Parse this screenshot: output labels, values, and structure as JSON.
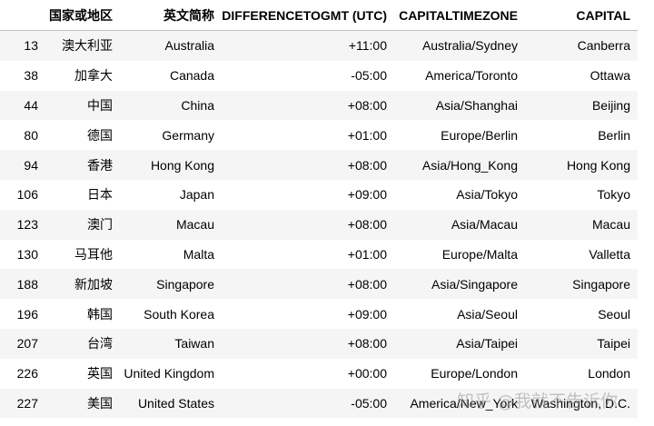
{
  "table": {
    "headers": [
      "",
      "国家或地区",
      "英文简称",
      "DIFFERENCETOGMT (UTC)",
      "CAPITALTIMEZONE",
      "CAPITAL"
    ],
    "rows": [
      [
        "13",
        "澳大利亚",
        "Australia",
        "+11:00",
        "Australia/Sydney",
        "Canberra"
      ],
      [
        "38",
        "加拿大",
        "Canada",
        "-05:00",
        "America/Toronto",
        "Ottawa"
      ],
      [
        "44",
        "中国",
        "China",
        "+08:00",
        "Asia/Shanghai",
        "Beijing"
      ],
      [
        "80",
        "德国",
        "Germany",
        "+01:00",
        "Europe/Berlin",
        "Berlin"
      ],
      [
        "94",
        "香港",
        "Hong Kong",
        "+08:00",
        "Asia/Hong_Kong",
        "Hong Kong"
      ],
      [
        "106",
        "日本",
        "Japan",
        "+09:00",
        "Asia/Tokyo",
        "Tokyo"
      ],
      [
        "123",
        "澳门",
        "Macau",
        "+08:00",
        "Asia/Macau",
        "Macau"
      ],
      [
        "130",
        "马耳他",
        "Malta",
        "+01:00",
        "Europe/Malta",
        "Valletta"
      ],
      [
        "188",
        "新加坡",
        "Singapore",
        "+08:00",
        "Asia/Singapore",
        "Singapore"
      ],
      [
        "196",
        "韩国",
        "South Korea",
        "+09:00",
        "Asia/Seoul",
        "Seoul"
      ],
      [
        "207",
        "台湾",
        "Taiwan",
        "+08:00",
        "Asia/Taipei",
        "Taipei"
      ],
      [
        "226",
        "英国",
        "United Kingdom",
        "+00:00",
        "Europe/London",
        "London"
      ],
      [
        "227",
        "美国",
        "United States",
        "-05:00",
        "America/New_York",
        "Washington, D.C."
      ]
    ]
  },
  "watermark": "知乎 @我就不告诉你"
}
